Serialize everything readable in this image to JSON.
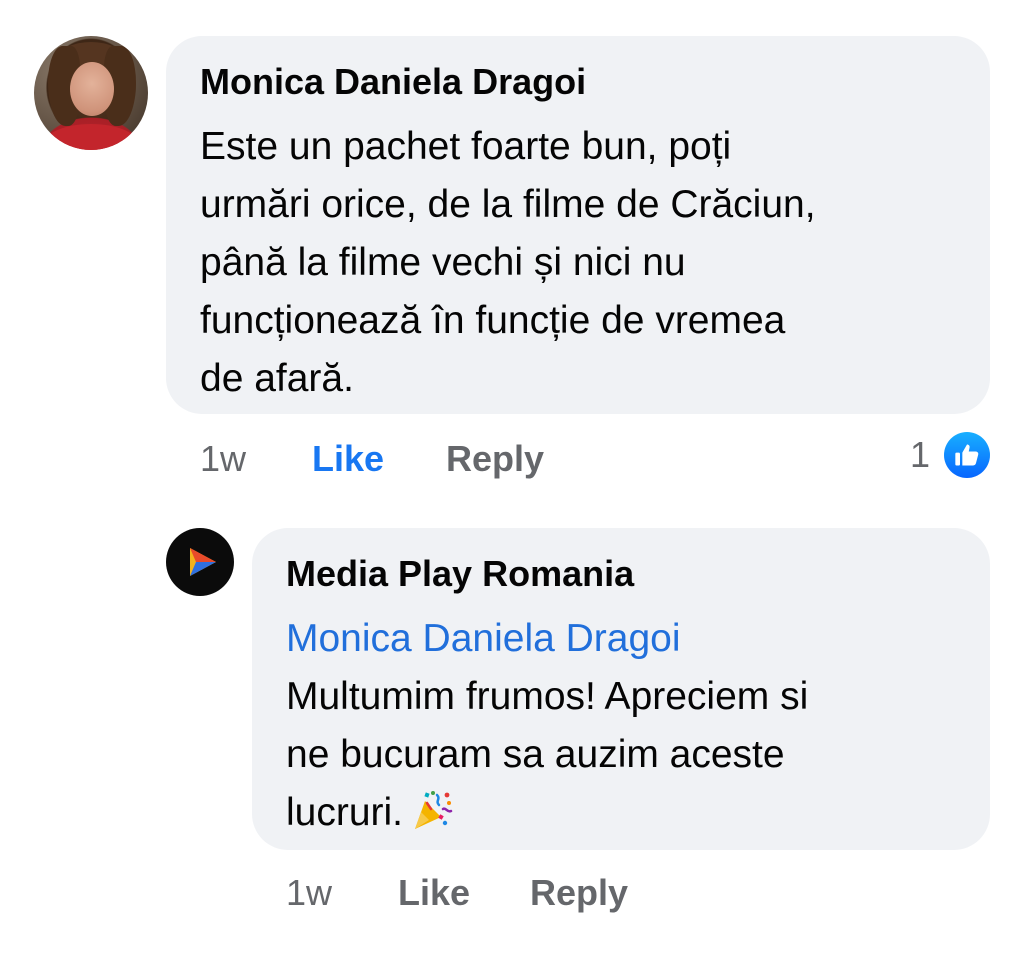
{
  "comments": [
    {
      "author": "Monica Daniela Dragoi",
      "text_lines": [
        "Este un pachet foarte bun, poți",
        "urmări orice, de la filme de Crăciun,",
        "până la filme vechi și nici nu",
        "funcționează în funcție de vremea",
        "de afară."
      ],
      "time": "1w",
      "like_label": "Like",
      "reply_label": "Reply",
      "liked_by_viewer": true,
      "reaction_count": "1",
      "reaction_icon": "thumbs-up-icon",
      "reaction_color": "#1877f2"
    },
    {
      "author": "Media Play Romania",
      "mention": "Monica Daniela Dragoi",
      "text_lines": [
        "Multumim frumos! Apreciem si",
        "ne bucuram sa auzim aceste",
        "lucruri."
      ],
      "emoji": "party-popper-icon",
      "time": "1w",
      "like_label": "Like",
      "reply_label": "Reply",
      "liked_by_viewer": false
    }
  ],
  "colors": {
    "bubble": "#f0f2f5",
    "secondary_text": "#65676b",
    "primary_text": "#050505",
    "like_active": "#1877f2",
    "mention": "#216fdb"
  }
}
